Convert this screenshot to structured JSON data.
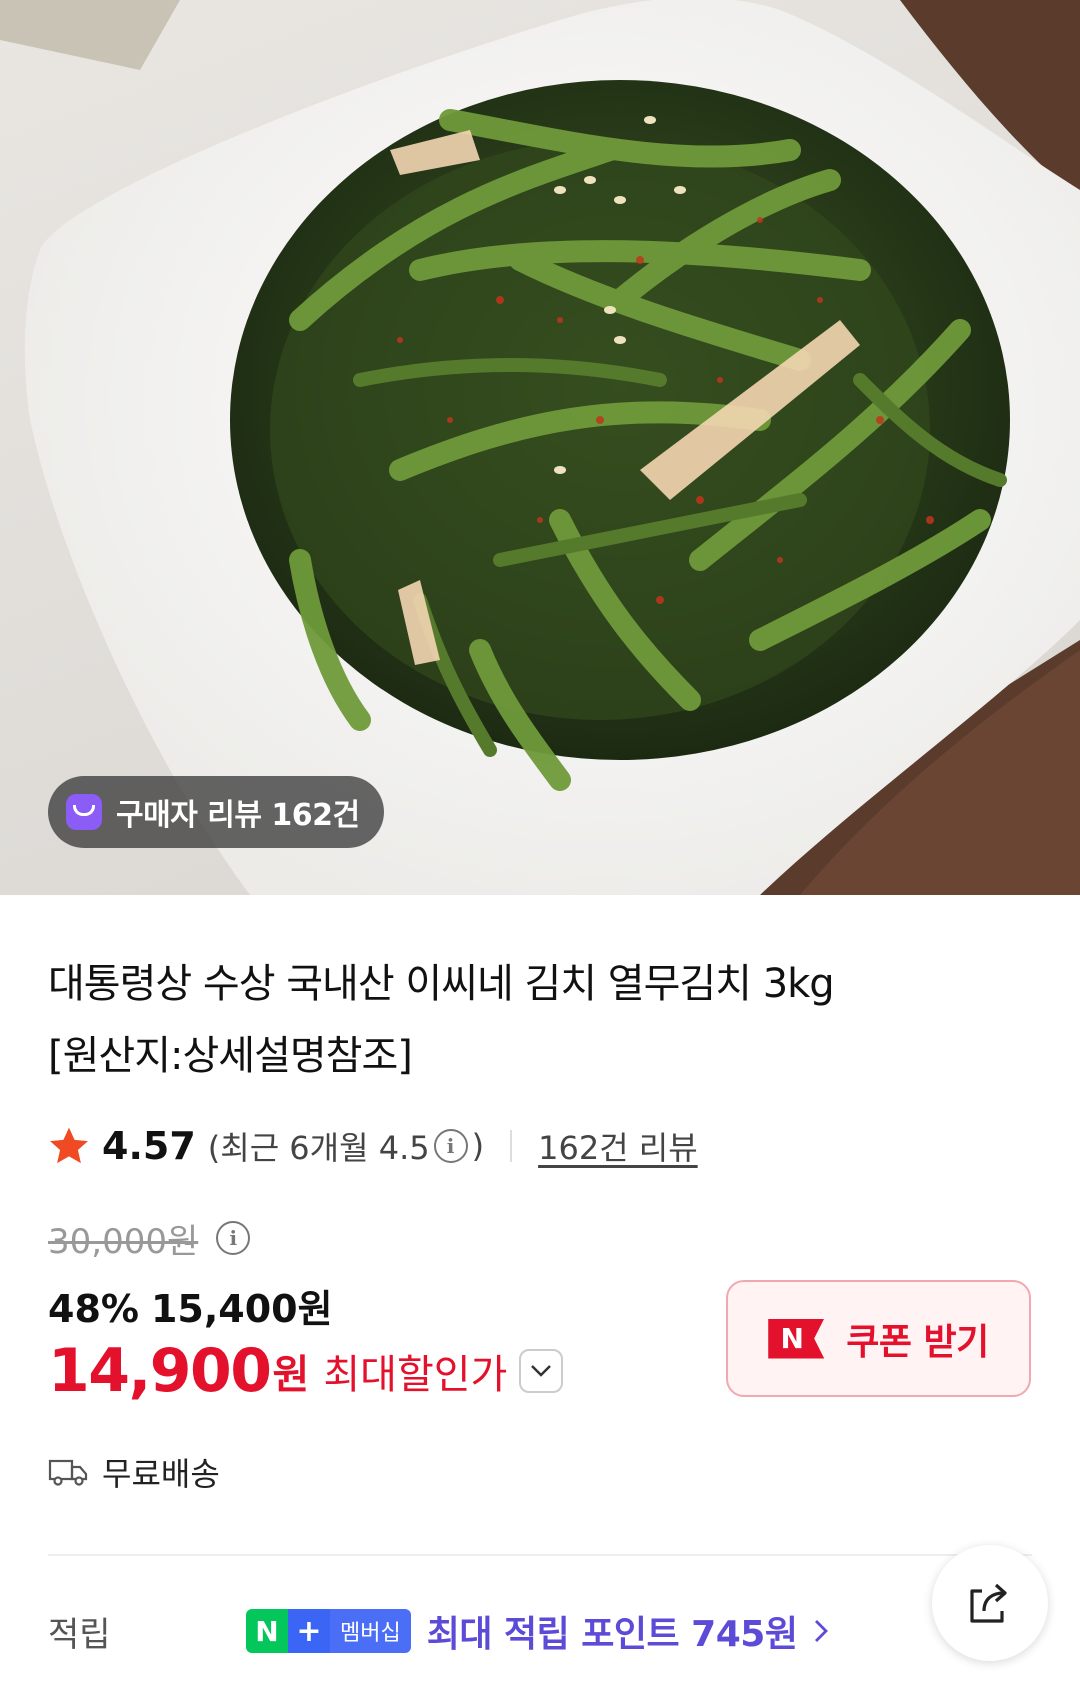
{
  "hero": {
    "review_pill": "구매자 리뷰 162건"
  },
  "product": {
    "title_line1": "대통령상 수상 국내산 이씨네 김치 열무김치 3kg",
    "title_line2": "[원산지:상세설명참조]"
  },
  "rating": {
    "score": "4.57",
    "recent_prefix": "(최근 6개월 4.5",
    "recent_suffix": ")",
    "reviews_link": "162건 리뷰"
  },
  "price": {
    "original": "30,000원",
    "discount_rate": "48%",
    "sale_price": "15,400원",
    "final_price": "14,900",
    "final_unit": "원",
    "final_label": "최대할인가"
  },
  "coupon": {
    "badge": "N",
    "label": "쿠폰 받기"
  },
  "shipping": {
    "label": "무료배송"
  },
  "points": {
    "label": "적립",
    "badge_n": "N",
    "badge_plus": "+",
    "badge_membership": "멤버십",
    "text": "최대 적립 포인트 745원"
  },
  "colors": {
    "accent_red": "#e4112c",
    "points_purple": "#5b4bd6",
    "naver_green": "#03c75a",
    "review_icon_purple": "#8b5cf6"
  },
  "icons": {
    "star": "star-icon",
    "info": "info-icon",
    "truck": "truck-icon",
    "share": "share-icon",
    "chevron": "chevron-down-icon"
  }
}
